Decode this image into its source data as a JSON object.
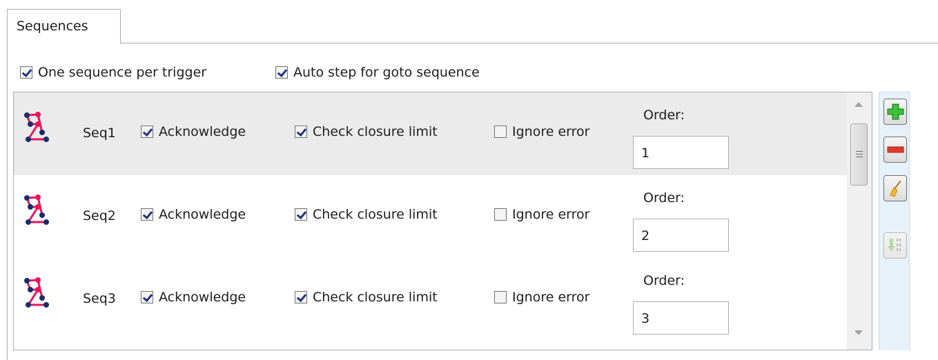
{
  "tabs": [
    {
      "label": "Sequences"
    }
  ],
  "options": {
    "one_per_trigger": {
      "label": "One sequence per trigger",
      "checked": true
    },
    "auto_step": {
      "label": "Auto step for goto sequence",
      "checked": true
    }
  },
  "sequences": [
    {
      "name": "Seq1",
      "acknowledge_label": "Acknowledge",
      "acknowledge": true,
      "closure_label": "Check closure limit",
      "closure": true,
      "ignore_label": "Ignore error",
      "ignore": false,
      "order_label": "Order:",
      "order": "1",
      "selected": true
    },
    {
      "name": "Seq2",
      "acknowledge_label": "Acknowledge",
      "acknowledge": true,
      "closure_label": "Check closure limit",
      "closure": true,
      "ignore_label": "Ignore error",
      "ignore": false,
      "order_label": "Order:",
      "order": "2",
      "selected": false
    },
    {
      "name": "Seq3",
      "acknowledge_label": "Acknowledge",
      "acknowledge": true,
      "closure_label": "Check closure limit",
      "closure": true,
      "ignore_label": "Ignore error",
      "ignore": false,
      "order_label": "Order:",
      "order": "3",
      "selected": false
    }
  ],
  "toolbar": [
    {
      "name": "add-button",
      "icon": "plus-icon",
      "enabled": true
    },
    {
      "name": "remove-button",
      "icon": "minus-icon",
      "enabled": true
    },
    {
      "name": "clear-button",
      "icon": "broom-icon",
      "enabled": true
    },
    {
      "name": "import-button",
      "icon": "download-binary-icon",
      "enabled": false
    }
  ],
  "colors": {
    "checkmark": "#22337f",
    "selected_row": "#ebebeb",
    "side_panel": "#e6f1f9",
    "icon_node_red": "#e8145a",
    "icon_node_blue": "#1a2b6b",
    "plus_green": "#2fa82f",
    "minus_red": "#e03a2a"
  }
}
